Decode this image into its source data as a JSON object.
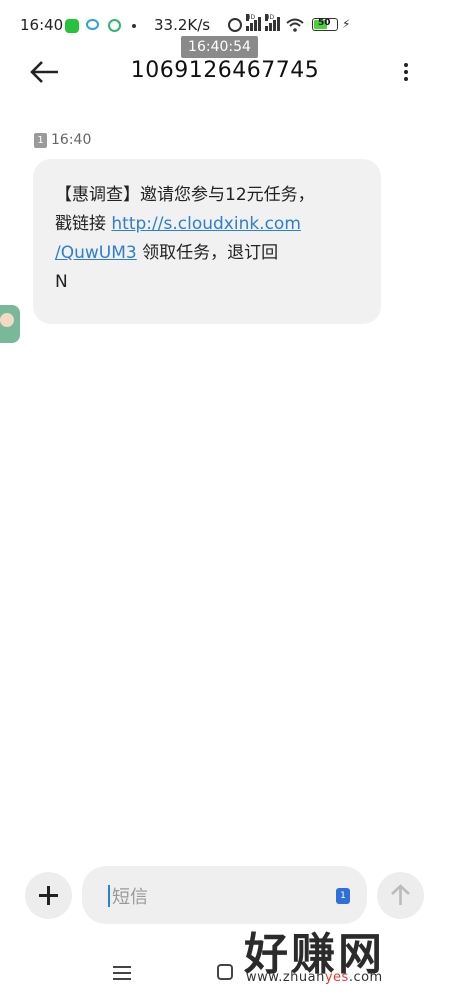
{
  "status_bar": {
    "time": "16:40",
    "net_speed": "33.2K/s",
    "battery": "50",
    "signal_tag": "HD",
    "icons": [
      "wechat-icon",
      "bubble-icon",
      "app-icon",
      "dot-icon",
      "alarm-icon",
      "signal-icon",
      "signal-icon",
      "wifi-icon",
      "battery-icon",
      "charging-icon"
    ]
  },
  "clock_overlay": "16:40:54",
  "header": {
    "title": "1069126467745",
    "back_icon": "arrow-left-icon",
    "menu_icon": "more-vertical-icon"
  },
  "message": {
    "sim": "1",
    "time": "16:40",
    "line1": "【惠调查】邀请您参与12元任务，",
    "line2_prefix": "戳链接 ",
    "link_part1": "http://s.cloudxink.com",
    "link_part2": "/QuwUM3",
    "line3_suffix": " 领取任务，退订回",
    "line4": "N"
  },
  "composer": {
    "placeholder": "短信",
    "sim": "1",
    "plus_icon": "plus-icon",
    "send_icon": "arrow-up-icon"
  },
  "watermark": {
    "brand": "好赚网",
    "url_pre": "www.zhuan",
    "url_hl": "yes",
    "url_post": ".com"
  }
}
